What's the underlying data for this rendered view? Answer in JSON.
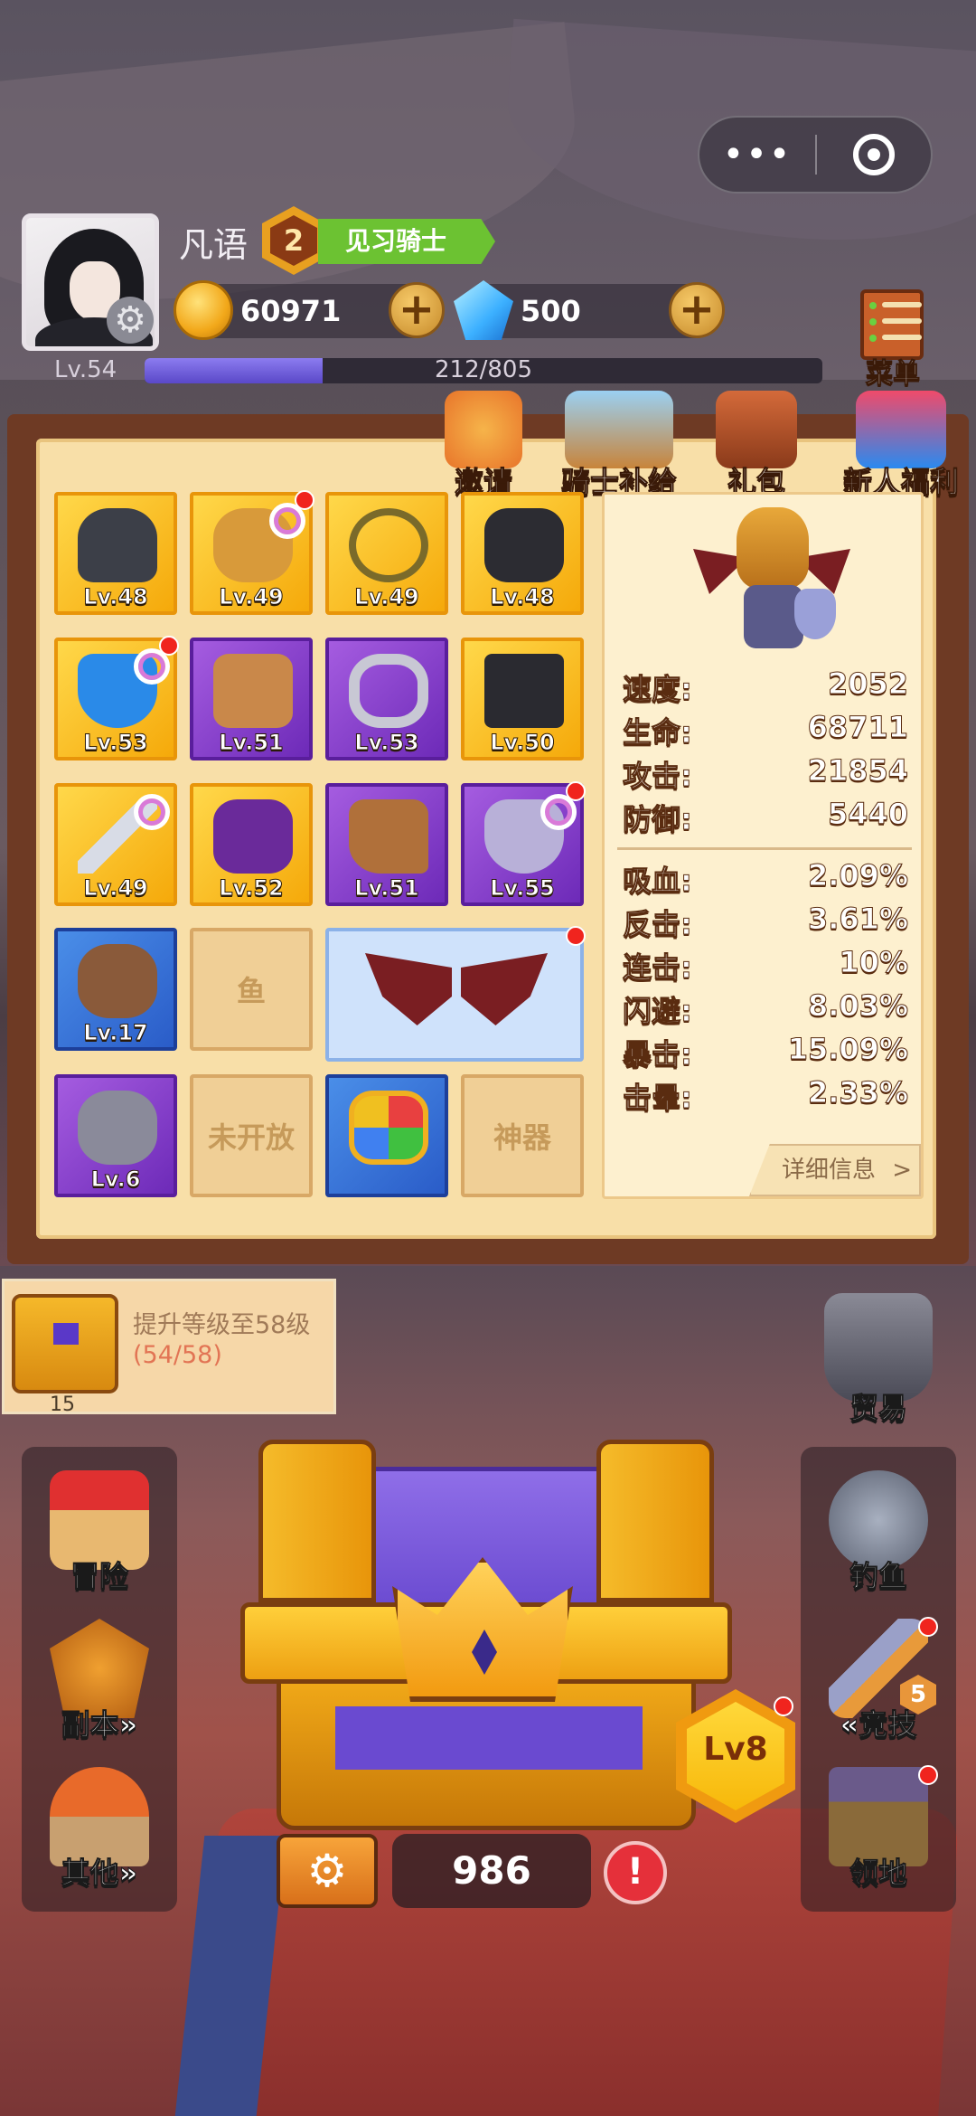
{
  "capsule": {
    "more_glyph": "•••",
    "close_icon": "target-ring-icon"
  },
  "player": {
    "name": "凡语",
    "rank_number": "2",
    "title": "见习骑士",
    "level": "Lv.54",
    "exp": "212/805",
    "exp_fraction": 0.263,
    "gold": "60971",
    "gems": "500"
  },
  "menu": {
    "label": "菜单"
  },
  "top_icons": [
    {
      "label": "邀请"
    },
    {
      "label": "骑士补给"
    },
    {
      "label": "礼包"
    },
    {
      "label": "新人福利"
    }
  ],
  "equipment": [
    {
      "lv": "Lv.48",
      "rarity": "gold",
      "icon": "helmet-icon"
    },
    {
      "lv": "Lv.49",
      "rarity": "gold",
      "icon": "golden-mask-icon"
    },
    {
      "lv": "Lv.49",
      "rarity": "gold",
      "icon": "necklace-icon"
    },
    {
      "lv": "Lv.48",
      "rarity": "gold",
      "icon": "shoulder-armor-icon"
    },
    {
      "lv": "Lv.53",
      "rarity": "gold",
      "icon": "shield-icon"
    },
    {
      "lv": "Lv.51",
      "rarity": "purple",
      "icon": "gauntlet-icon"
    },
    {
      "lv": "Lv.53",
      "rarity": "purple",
      "icon": "skull-ring-icon"
    },
    {
      "lv": "Lv.50",
      "rarity": "gold",
      "icon": "chest-armor-icon"
    },
    {
      "lv": "Lv.49",
      "rarity": "gold",
      "icon": "sword-icon"
    },
    {
      "lv": "Lv.52",
      "rarity": "gold",
      "icon": "belt-icon"
    },
    {
      "lv": "Lv.51",
      "rarity": "purple",
      "icon": "boots-icon"
    },
    {
      "lv": "Lv.55",
      "rarity": "purple",
      "icon": "bone-shield-icon"
    },
    {
      "lv": "Lv.17",
      "rarity": "blue",
      "icon": "pet-monkey-icon"
    },
    {
      "lv": "Lv.6",
      "rarity": "purple",
      "icon": "pet-wolf-icon"
    }
  ],
  "empty_slots": {
    "fish": "鱼",
    "locked": "未开放",
    "artifact": "神器"
  },
  "stats": {
    "base": [
      {
        "k": "速度:",
        "v": "2052"
      },
      {
        "k": "生命:",
        "v": "68711"
      },
      {
        "k": "攻击:",
        "v": "21854"
      },
      {
        "k": "防御:",
        "v": "5440"
      }
    ],
    "extra": [
      {
        "k": "吸血:",
        "v": "2.09%"
      },
      {
        "k": "反击:",
        "v": "3.61%"
      },
      {
        "k": "连击:",
        "v": "10%"
      },
      {
        "k": "闪避:",
        "v": "8.03%"
      },
      {
        "k": "暴击:",
        "v": "15.09%"
      },
      {
        "k": "击晕:",
        "v": "2.33%"
      }
    ],
    "detail_label": "详细信息",
    "detail_arrow": ">"
  },
  "quest": {
    "title": "提升等级至58级",
    "progress": "(54/58)",
    "count": "15"
  },
  "left_side": [
    {
      "label": "冒险"
    },
    {
      "label": "副本»"
    },
    {
      "label": "其他»"
    }
  ],
  "right_side": [
    {
      "label": "贸易"
    },
    {
      "label": "钓鱼"
    },
    {
      "label": "«竞技",
      "badge": "5"
    },
    {
      "label": "领地"
    }
  ],
  "chest": {
    "level": "Lv8",
    "counter": "986",
    "gear_glyph": "⚙",
    "warn_glyph": "!"
  },
  "colors": {
    "gold_slot": "#f5a90a",
    "purple_slot": "#6d2ab8",
    "blue_slot": "#2a5cc8",
    "exp_fill": "#6a58d8",
    "red_dot": "#f0241e"
  }
}
